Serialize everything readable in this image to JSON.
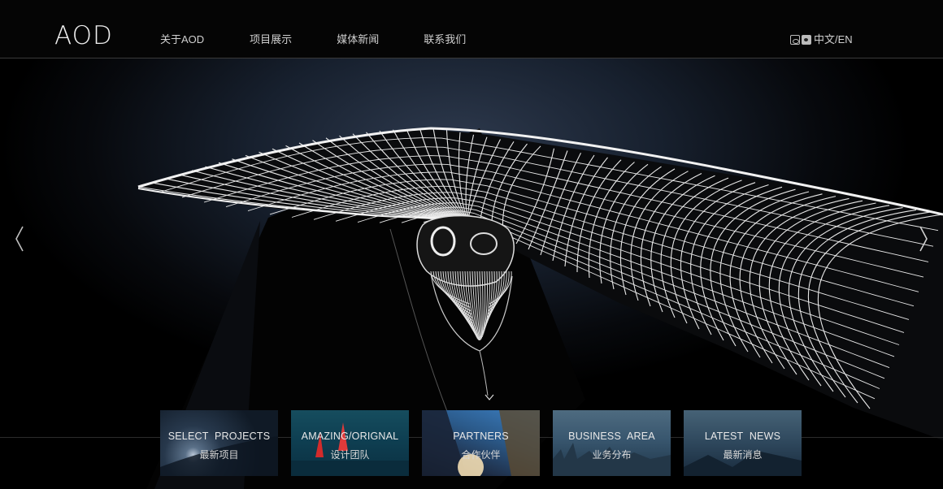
{
  "header": {
    "logo": "AOD",
    "nav": [
      "关于AOD",
      "项目展示",
      "媒体新闻",
      "联系我们"
    ],
    "lang_label": "中文/EN"
  },
  "icons": {
    "social_1": "weibo-icon",
    "social_2": "wechat-icon",
    "prev": "chevron-left-icon",
    "next": "chevron-right-icon"
  },
  "tiles": [
    {
      "en": "SELECT PROJECTS",
      "cn": "最新项目"
    },
    {
      "en": "AMAZING/ORIGNAL",
      "cn": "设计团队"
    },
    {
      "en": "PARTNERS",
      "cn": "合作伙伴"
    },
    {
      "en": "BUSINESS AREA",
      "cn": "业务分布"
    },
    {
      "en": "LATEST NEWS",
      "cn": "最新消息"
    }
  ],
  "colors": {
    "background": "#000000",
    "divider": "#3a3a3a",
    "text": "#cfcfcf"
  }
}
